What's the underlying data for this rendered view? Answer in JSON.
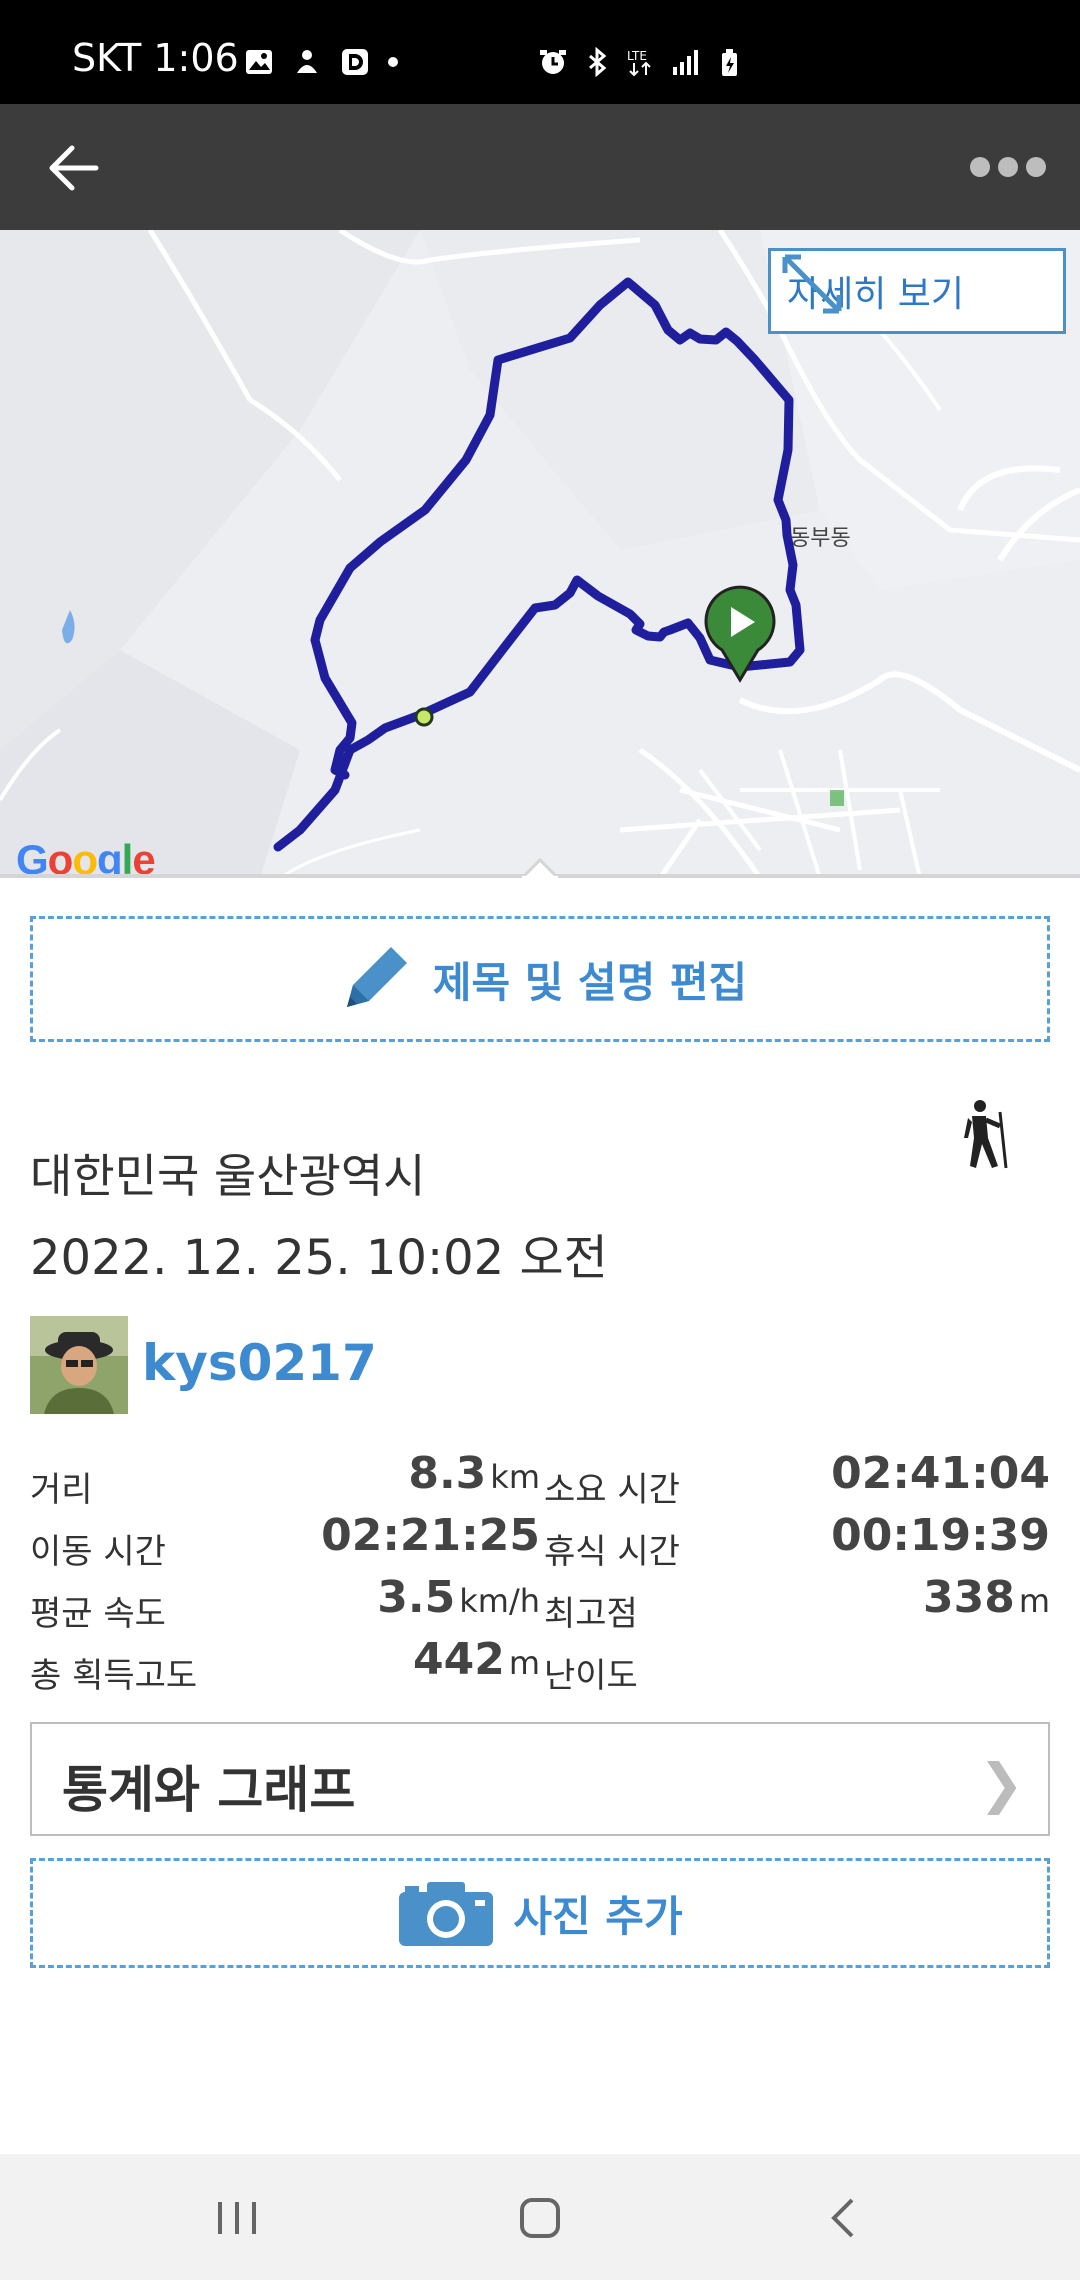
{
  "status_bar": {
    "carrier_time": "SKT 1:06",
    "left_icons": [
      "image-icon",
      "notification-icon",
      "d-app-icon",
      "dot-icon"
    ],
    "right_icons": [
      "alarm-icon",
      "bluetooth-icon",
      "lte-icon",
      "signal-icon",
      "battery-icon"
    ]
  },
  "app_bar": {
    "back_icon": "arrow-left-icon",
    "more_icon": "more-dots-icon"
  },
  "map": {
    "detail_button_label": "자세히 보기",
    "poi_label": "동부동",
    "google_logo": "Google",
    "route_color": "#1f1f9e",
    "start_marker_color": "#3a8a3a"
  },
  "edit_button": {
    "label": "제목 및 설명 편집",
    "icon": "pencil-icon"
  },
  "activity": {
    "location": "대한민국 울산광역시",
    "datetime": "2022. 12. 25. 10:02 오전",
    "type_icon": "hiker-icon",
    "username": "kys0217"
  },
  "stats": {
    "distance_label": "거리",
    "distance_value": "8.3",
    "distance_unit": "km",
    "duration_label": "소요 시간",
    "duration_value": "02:41:04",
    "moving_label": "이동 시간",
    "moving_value": "02:21:25",
    "rest_label": "휴식 시간",
    "rest_value": "00:19:39",
    "speed_label": "평균 속도",
    "speed_value": "3.5",
    "speed_unit": "km/h",
    "max_label": "최고점",
    "max_value": "338",
    "max_unit": "m",
    "gain_label": "총 획득고도",
    "gain_value": "442",
    "gain_unit": "m",
    "difficulty_label": "난이도",
    "difficulty_value": ""
  },
  "graph_button": {
    "label": "통계와 그래프",
    "chevron": "❯"
  },
  "photo_button": {
    "label": "사진 추가",
    "icon": "camera-icon"
  },
  "colors": {
    "accent": "#3d8ad0",
    "app_bar": "#3c3c3c"
  }
}
